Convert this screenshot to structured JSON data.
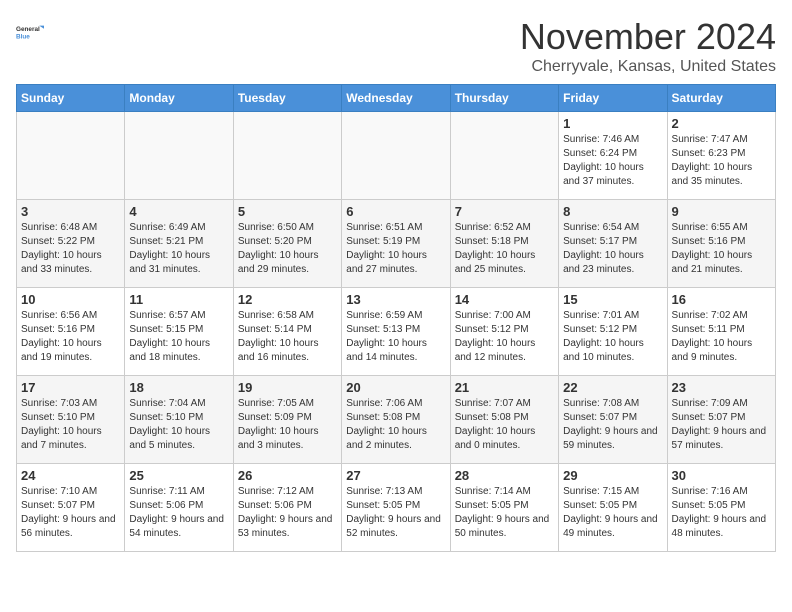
{
  "logo": {
    "line1": "General",
    "line2": "Blue"
  },
  "title": "November 2024",
  "location": "Cherryvale, Kansas, United States",
  "weekdays": [
    "Sunday",
    "Monday",
    "Tuesday",
    "Wednesday",
    "Thursday",
    "Friday",
    "Saturday"
  ],
  "weeks": [
    [
      {
        "day": "",
        "info": ""
      },
      {
        "day": "",
        "info": ""
      },
      {
        "day": "",
        "info": ""
      },
      {
        "day": "",
        "info": ""
      },
      {
        "day": "",
        "info": ""
      },
      {
        "day": "1",
        "info": "Sunrise: 7:46 AM\nSunset: 6:24 PM\nDaylight: 10 hours and 37 minutes."
      },
      {
        "day": "2",
        "info": "Sunrise: 7:47 AM\nSunset: 6:23 PM\nDaylight: 10 hours and 35 minutes."
      }
    ],
    [
      {
        "day": "3",
        "info": "Sunrise: 6:48 AM\nSunset: 5:22 PM\nDaylight: 10 hours and 33 minutes."
      },
      {
        "day": "4",
        "info": "Sunrise: 6:49 AM\nSunset: 5:21 PM\nDaylight: 10 hours and 31 minutes."
      },
      {
        "day": "5",
        "info": "Sunrise: 6:50 AM\nSunset: 5:20 PM\nDaylight: 10 hours and 29 minutes."
      },
      {
        "day": "6",
        "info": "Sunrise: 6:51 AM\nSunset: 5:19 PM\nDaylight: 10 hours and 27 minutes."
      },
      {
        "day": "7",
        "info": "Sunrise: 6:52 AM\nSunset: 5:18 PM\nDaylight: 10 hours and 25 minutes."
      },
      {
        "day": "8",
        "info": "Sunrise: 6:54 AM\nSunset: 5:17 PM\nDaylight: 10 hours and 23 minutes."
      },
      {
        "day": "9",
        "info": "Sunrise: 6:55 AM\nSunset: 5:16 PM\nDaylight: 10 hours and 21 minutes."
      }
    ],
    [
      {
        "day": "10",
        "info": "Sunrise: 6:56 AM\nSunset: 5:16 PM\nDaylight: 10 hours and 19 minutes."
      },
      {
        "day": "11",
        "info": "Sunrise: 6:57 AM\nSunset: 5:15 PM\nDaylight: 10 hours and 18 minutes."
      },
      {
        "day": "12",
        "info": "Sunrise: 6:58 AM\nSunset: 5:14 PM\nDaylight: 10 hours and 16 minutes."
      },
      {
        "day": "13",
        "info": "Sunrise: 6:59 AM\nSunset: 5:13 PM\nDaylight: 10 hours and 14 minutes."
      },
      {
        "day": "14",
        "info": "Sunrise: 7:00 AM\nSunset: 5:12 PM\nDaylight: 10 hours and 12 minutes."
      },
      {
        "day": "15",
        "info": "Sunrise: 7:01 AM\nSunset: 5:12 PM\nDaylight: 10 hours and 10 minutes."
      },
      {
        "day": "16",
        "info": "Sunrise: 7:02 AM\nSunset: 5:11 PM\nDaylight: 10 hours and 9 minutes."
      }
    ],
    [
      {
        "day": "17",
        "info": "Sunrise: 7:03 AM\nSunset: 5:10 PM\nDaylight: 10 hours and 7 minutes."
      },
      {
        "day": "18",
        "info": "Sunrise: 7:04 AM\nSunset: 5:10 PM\nDaylight: 10 hours and 5 minutes."
      },
      {
        "day": "19",
        "info": "Sunrise: 7:05 AM\nSunset: 5:09 PM\nDaylight: 10 hours and 3 minutes."
      },
      {
        "day": "20",
        "info": "Sunrise: 7:06 AM\nSunset: 5:08 PM\nDaylight: 10 hours and 2 minutes."
      },
      {
        "day": "21",
        "info": "Sunrise: 7:07 AM\nSunset: 5:08 PM\nDaylight: 10 hours and 0 minutes."
      },
      {
        "day": "22",
        "info": "Sunrise: 7:08 AM\nSunset: 5:07 PM\nDaylight: 9 hours and 59 minutes."
      },
      {
        "day": "23",
        "info": "Sunrise: 7:09 AM\nSunset: 5:07 PM\nDaylight: 9 hours and 57 minutes."
      }
    ],
    [
      {
        "day": "24",
        "info": "Sunrise: 7:10 AM\nSunset: 5:07 PM\nDaylight: 9 hours and 56 minutes."
      },
      {
        "day": "25",
        "info": "Sunrise: 7:11 AM\nSunset: 5:06 PM\nDaylight: 9 hours and 54 minutes."
      },
      {
        "day": "26",
        "info": "Sunrise: 7:12 AM\nSunset: 5:06 PM\nDaylight: 9 hours and 53 minutes."
      },
      {
        "day": "27",
        "info": "Sunrise: 7:13 AM\nSunset: 5:05 PM\nDaylight: 9 hours and 52 minutes."
      },
      {
        "day": "28",
        "info": "Sunrise: 7:14 AM\nSunset: 5:05 PM\nDaylight: 9 hours and 50 minutes."
      },
      {
        "day": "29",
        "info": "Sunrise: 7:15 AM\nSunset: 5:05 PM\nDaylight: 9 hours and 49 minutes."
      },
      {
        "day": "30",
        "info": "Sunrise: 7:16 AM\nSunset: 5:05 PM\nDaylight: 9 hours and 48 minutes."
      }
    ]
  ]
}
